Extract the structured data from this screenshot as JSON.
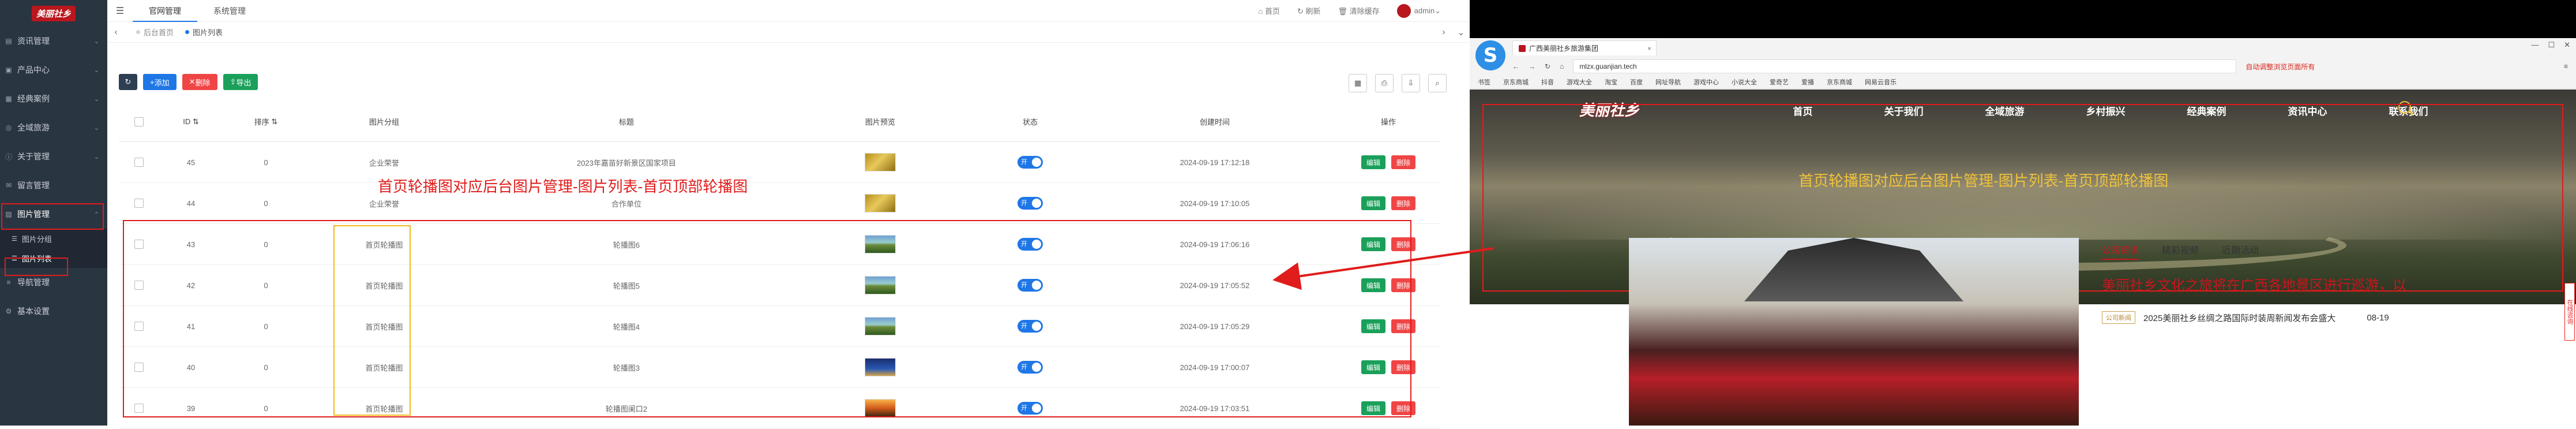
{
  "admin": {
    "logo_text": "美丽社乡",
    "sidebar": {
      "items": [
        {
          "label": "资讯管理",
          "icon": "file-icon"
        },
        {
          "label": "产品中心",
          "icon": "box-icon"
        },
        {
          "label": "经典案例",
          "icon": "case-icon"
        },
        {
          "label": "全域旅游",
          "icon": "globe-icon"
        },
        {
          "label": "关于管理",
          "icon": "info-icon"
        },
        {
          "label": "留言管理",
          "icon": "message-icon"
        },
        {
          "label": "图片管理",
          "icon": "image-icon"
        }
      ],
      "sub_items": [
        {
          "label": "图片分组"
        },
        {
          "label": "图片列表"
        }
      ],
      "bottom_items": [
        {
          "label": "导航管理",
          "icon": "nav-icon"
        },
        {
          "label": "基本设置",
          "icon": "gear-icon"
        }
      ]
    },
    "topbar": {
      "tabs": [
        "官网管理",
        "系统管理"
      ],
      "right": [
        "首页",
        "刷新",
        "清除缓存",
        "admin"
      ]
    },
    "tabbar": {
      "pages": [
        "后台首页",
        "图片列表"
      ]
    },
    "toolbar": {
      "add": "添加",
      "delete": "删除",
      "export": "导出"
    },
    "table": {
      "headers": [
        "ID",
        "排序",
        "图片分组",
        "标题",
        "图片预览",
        "状态",
        "创建时间",
        "操作"
      ],
      "rows": [
        {
          "id": "45",
          "sort": "0",
          "category": "企业荣誉",
          "title": "2023年嘉苗好新景区国家项目",
          "thumb": "gold",
          "status": "开",
          "time": "2024-09-19 17:12:18"
        },
        {
          "id": "44",
          "sort": "0",
          "category": "企业荣誉",
          "title": "合作单位",
          "thumb": "gold",
          "status": "开",
          "time": "2024-09-19 17:10:05"
        },
        {
          "id": "43",
          "sort": "0",
          "category": "首页轮播图",
          "title": "轮播图6",
          "thumb": "land",
          "status": "开",
          "time": "2024-09-19 17:06:16"
        },
        {
          "id": "42",
          "sort": "0",
          "category": "首页轮播图",
          "title": "轮播图5",
          "thumb": "land",
          "status": "开",
          "time": "2024-09-19 17:05:52"
        },
        {
          "id": "41",
          "sort": "0",
          "category": "首页轮播图",
          "title": "轮播图4",
          "thumb": "land",
          "status": "开",
          "time": "2024-09-19 17:05:29"
        },
        {
          "id": "40",
          "sort": "0",
          "category": "首页轮播图",
          "title": "轮播图3",
          "thumb": "night",
          "status": "开",
          "time": "2024-09-19 17:00:07"
        },
        {
          "id": "39",
          "sort": "0",
          "category": "首页轮播图",
          "title": "轮播图阑口2",
          "thumb": "sunset",
          "status": "开",
          "time": "2024-09-19 17:03:51"
        }
      ],
      "edit_label": "编辑",
      "delete_label": "删除"
    },
    "annotation": "首页轮播图对应后台图片管理-图片列表-首页顶部轮播图"
  },
  "site": {
    "tab_title": "广西美丽社乡旅游集团",
    "url": "mlzx.guanjian.tech",
    "promo": "自动调整浏览页面所有",
    "bookmarks": [
      "书签",
      "京东商城",
      "抖音",
      "游戏大全",
      "淘宝",
      "百度",
      "网址导航",
      "游戏中心",
      "小说大全",
      "爱奇艺",
      "爱播",
      "京东商城",
      "网易云音乐"
    ],
    "logo": "美丽社乡",
    "nav": [
      "首页",
      "关于我们",
      "全域旅游",
      "乡村振兴",
      "经典案例",
      "资讯中心",
      "联系我们"
    ],
    "annotation": "首页轮播图对应后台图片管理-图片列表-首页顶部轮播图",
    "side_tag": "在线咨询",
    "news": {
      "tabs": [
        "公司资讯",
        "精彩视频",
        "近期活动"
      ],
      "headline": "美丽社乡文化之旅将在广西各地景区进行巡游，以",
      "items": [
        {
          "badge": "公司新闻",
          "text": "2025美丽社乡丝绸之路国际时装周新闻发布会盛大",
          "date": "08-19"
        }
      ]
    }
  },
  "colors": {
    "annotation_red": "#e01c1c",
    "accent_blue": "#1f77e6",
    "sidebar_bg": "#2a3542",
    "yellow": "#f0c23a"
  }
}
